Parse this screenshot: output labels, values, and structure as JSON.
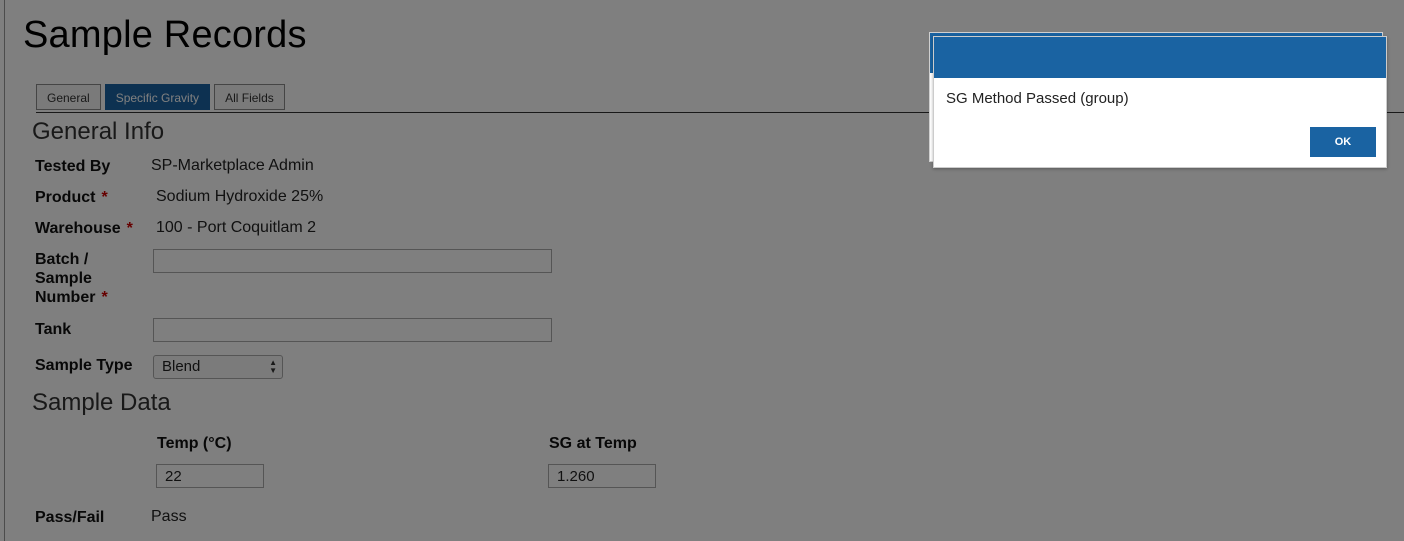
{
  "page": {
    "title": "Sample Records"
  },
  "tabs": [
    {
      "label": "General",
      "active": false
    },
    {
      "label": "Specific Gravity",
      "active": true
    },
    {
      "label": "All Fields",
      "active": false
    }
  ],
  "general_info": {
    "heading": "General Info",
    "tested_by": {
      "label": "Tested By",
      "value": "SP-Marketplace Admin"
    },
    "product": {
      "label": "Product",
      "required": "*",
      "value": "Sodium Hydroxide 25%"
    },
    "warehouse": {
      "label": "Warehouse",
      "required": "*",
      "value": "100 - Port Coquitlam 2"
    },
    "batch": {
      "label_line1": "Batch /",
      "label_line2": "Sample",
      "label_line3": "Number",
      "required": "*",
      "value": ""
    },
    "tank": {
      "label": "Tank",
      "value": ""
    },
    "sample_type": {
      "label": "Sample Type",
      "value": "Blend"
    }
  },
  "sample_data": {
    "heading": "Sample Data",
    "temp": {
      "label": "Temp (°C)",
      "value": "22"
    },
    "sg": {
      "label": "SG at Temp",
      "value": "1.260"
    },
    "pass_fail": {
      "label": "Pass/Fail",
      "value": "Pass"
    }
  },
  "dialog": {
    "message": "SG Method Passed (group)",
    "ok_label": "OK",
    "header_color": "#1a63a2"
  },
  "colors": {
    "accent": "#1a63a2",
    "required": "#cc0000"
  }
}
